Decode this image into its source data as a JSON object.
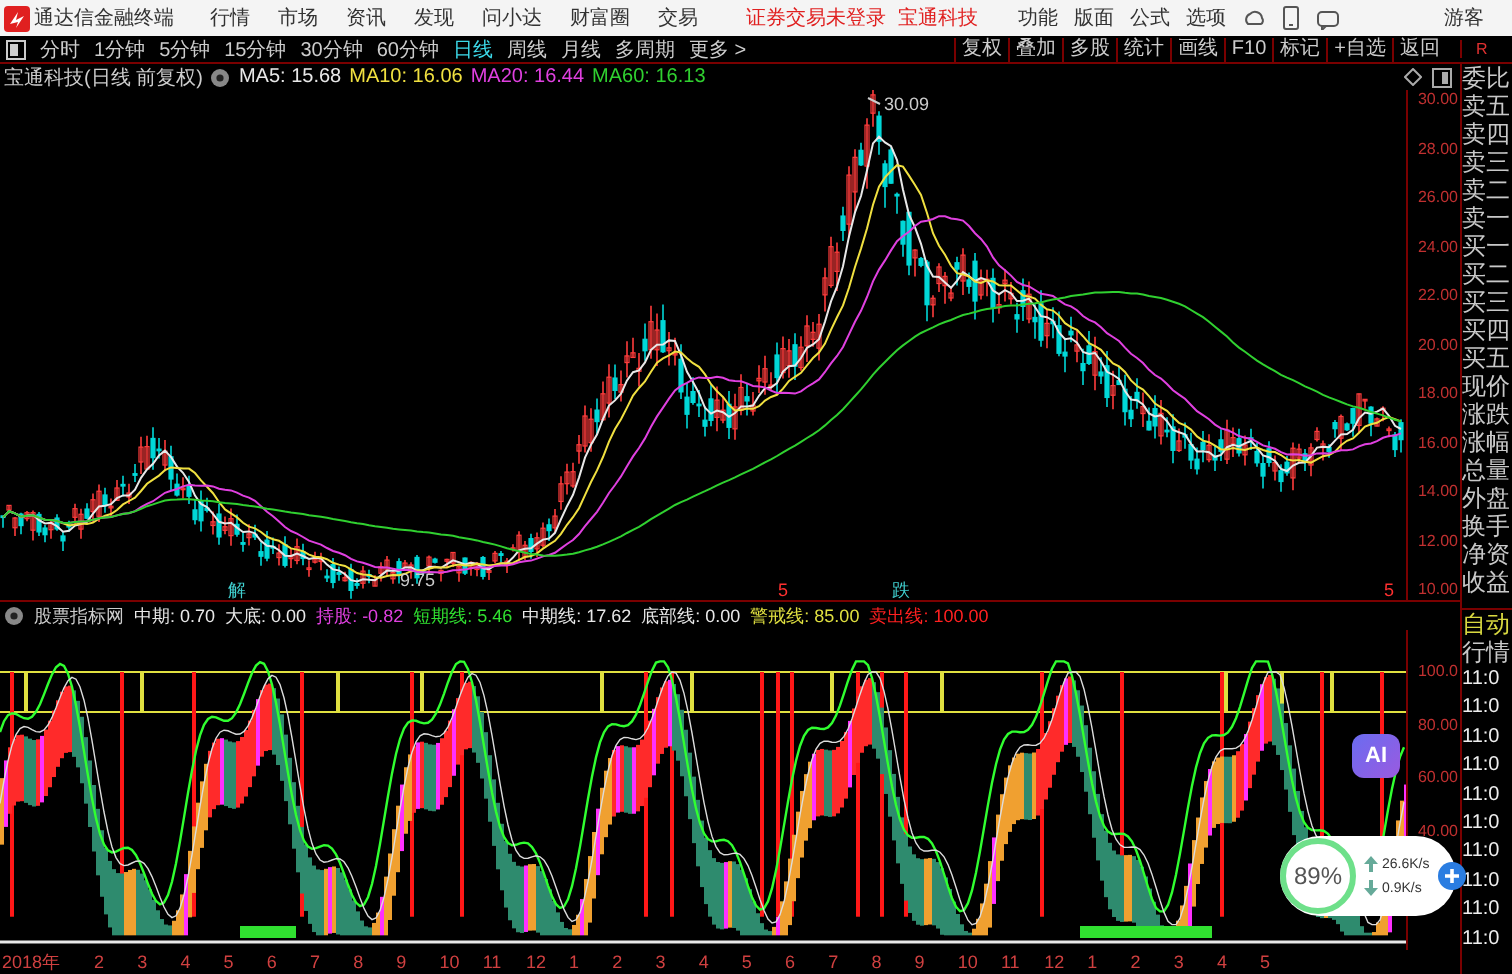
{
  "app": {
    "title": "通达信金融终端",
    "menu": [
      "行情",
      "市场",
      "资讯",
      "发现",
      "问小达",
      "财富圈",
      "交易"
    ],
    "login_status": "证券交易未登录",
    "stock_name": "宝通科技",
    "right_menu": [
      "功能",
      "版面",
      "公式",
      "选项"
    ],
    "user": "游客"
  },
  "periods": [
    {
      "label": "分时",
      "selected": false
    },
    {
      "label": "1分钟",
      "selected": false
    },
    {
      "label": "5分钟",
      "selected": false
    },
    {
      "label": "15分钟",
      "selected": false
    },
    {
      "label": "30分钟",
      "selected": false
    },
    {
      "label": "60分钟",
      "selected": false
    },
    {
      "label": "日线",
      "selected": true
    },
    {
      "label": "周线",
      "selected": false
    },
    {
      "label": "月线",
      "selected": false
    },
    {
      "label": "多周期",
      "selected": false
    },
    {
      "label": "更多 >",
      "selected": false
    }
  ],
  "tools": [
    "复权",
    "叠加",
    "多股",
    "统计",
    "画线",
    "F10",
    "标记",
    "+自选",
    "返回"
  ],
  "tool_corner": "R",
  "chart": {
    "title": "宝通科技(日线 前复权)",
    "averages": [
      {
        "label": "MA5: 15.68",
        "color": "#e8e8e8"
      },
      {
        "label": "MA10: 16.06",
        "color": "#f0e040"
      },
      {
        "label": "MA20: 16.44",
        "color": "#e040e0"
      },
      {
        "label": "MA60: 16.13",
        "color": "#30d030"
      }
    ],
    "price_axis": [
      "30.00",
      "28.00",
      "26.00",
      "24.00",
      "22.00",
      "20.00",
      "18.00",
      "16.00",
      "14.00",
      "12.00",
      "10.00"
    ],
    "high_label": "30.09",
    "low_label": "9.75",
    "markers": [
      {
        "text": "解",
        "color": "#40d0d0"
      },
      {
        "text": "5",
        "color": "#ff3030"
      },
      {
        "text": "跌",
        "color": "#40d0d0"
      },
      {
        "text": "5",
        "color": "#ff3030"
      }
    ]
  },
  "indicator": {
    "name": "股票指标网",
    "values": [
      {
        "label": "中期: 0.70",
        "color": "#e8e8e8"
      },
      {
        "label": "大底: 0.00",
        "color": "#e8e8e8"
      },
      {
        "label": "持股: -0.82",
        "color": "#e040e0"
      },
      {
        "label": "短期线: 5.46",
        "color": "#30e030"
      },
      {
        "label": "中期线: 17.62",
        "color": "#e8e8e8"
      },
      {
        "label": "底部线: 0.00",
        "color": "#e8e8e8"
      },
      {
        "label": "警戒线: 85.00",
        "color": "#e0e040"
      },
      {
        "label": "卖出线: 100.00",
        "color": "#ff2020"
      }
    ],
    "axis": [
      "100.0",
      "80.00",
      "60.00",
      "40.00"
    ]
  },
  "dates": [
    "2018年",
    "2",
    "3",
    "4",
    "5",
    "6",
    "7",
    "8",
    "9",
    "10",
    "11",
    "12",
    "1",
    "2",
    "3",
    "4",
    "5",
    "6",
    "7",
    "8",
    "9",
    "10",
    "11",
    "12",
    "1",
    "2",
    "3",
    "4",
    "5"
  ],
  "quote_labels": [
    "委比",
    "卖五",
    "卖四",
    "卖三",
    "卖二",
    "卖一",
    "买一",
    "买二",
    "买三",
    "买四",
    "买五",
    "现价",
    "涨跌",
    "涨幅",
    "总量",
    "外盘",
    "换手",
    "净资",
    "收益"
  ],
  "side_mode": "自动",
  "side_title": "行情",
  "times": [
    "11:0",
    "11:0",
    "11:0",
    "11:0",
    "11:0",
    "11:0",
    "11:0",
    "11:0",
    "11:0",
    "11:0"
  ],
  "ai_button": "AI",
  "speed_widget": {
    "percent": "89%",
    "upload": "26.6K/s",
    "download": "0.9K/s"
  }
}
